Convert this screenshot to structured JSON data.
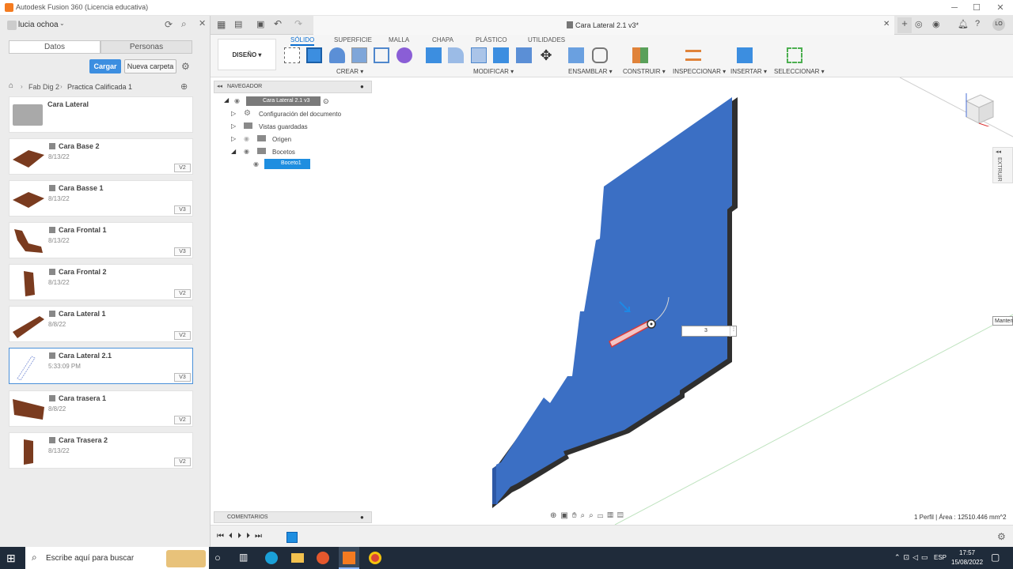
{
  "window": {
    "title": "Autodesk Fusion 360 (Licencia educativa)"
  },
  "left_panel": {
    "user": "lucia ochoa",
    "tabs": [
      "Datos",
      "Personas"
    ],
    "upload_label": "Cargar",
    "new_folder_label": "Nueva carpeta",
    "breadcrumb": [
      "Fab Dig 2",
      "Practica Calificada 1"
    ],
    "folder_name": "Cara Lateral",
    "files": [
      {
        "name": "Cara Base 2",
        "date": "8/13/22",
        "version": "V2"
      },
      {
        "name": "Cara Basse 1",
        "date": "8/13/22",
        "version": "V3"
      },
      {
        "name": "Cara Frontal 1",
        "date": "8/13/22",
        "version": "V3"
      },
      {
        "name": "Cara Frontal 2",
        "date": "8/13/22",
        "version": "V2"
      },
      {
        "name": "Cara Lateral 1",
        "date": "8/8/22",
        "version": "V2"
      },
      {
        "name": "Cara Lateral 2.1",
        "date": "5:33:09 PM",
        "version": "V3"
      },
      {
        "name": "Cara trasera 1",
        "date": "8/8/22",
        "version": "V2"
      },
      {
        "name": "Cara Trasera 2",
        "date": "8/13/22",
        "version": "V2"
      }
    ]
  },
  "doc_tab": {
    "title": "Cara Lateral 2.1 v3*"
  },
  "toolbar": {
    "workspace": "DISEÑO",
    "tabs": [
      "SÓLIDO",
      "SUPERFICIE",
      "MALLA",
      "CHAPA",
      "PLÁSTICO",
      "UTILIDADES"
    ],
    "groups": [
      "CREAR",
      "MODIFICAR",
      "ENSAMBLAR",
      "CONSTRUIR",
      "INSPECCIONAR",
      "INSERTAR",
      "SELECCIONAR"
    ]
  },
  "navigator": {
    "title": "NAVEGADOR",
    "root": "Cara Lateral 2.1 v3",
    "items": [
      "Configuración del documento",
      "Vistas guardadas",
      "Origen",
      "Bocetos",
      "Boceto1"
    ]
  },
  "canvas": {
    "dimension_value": "3",
    "side_panel_label": "EXTRUIR",
    "tooltip_cut": "Manten",
    "status": "1 Perfil | Área : 12510.446 mm^2"
  },
  "comments": {
    "title": "COMENTARIOS"
  },
  "taskbar": {
    "search_placeholder": "Escribe aquí para buscar",
    "lang": "ESP",
    "time": "17:57",
    "date": "15/08/2022"
  },
  "colors": {
    "accent": "#0a6ed1",
    "body_blue": "#3b6fc4",
    "body_edge": "#2d58a6"
  }
}
